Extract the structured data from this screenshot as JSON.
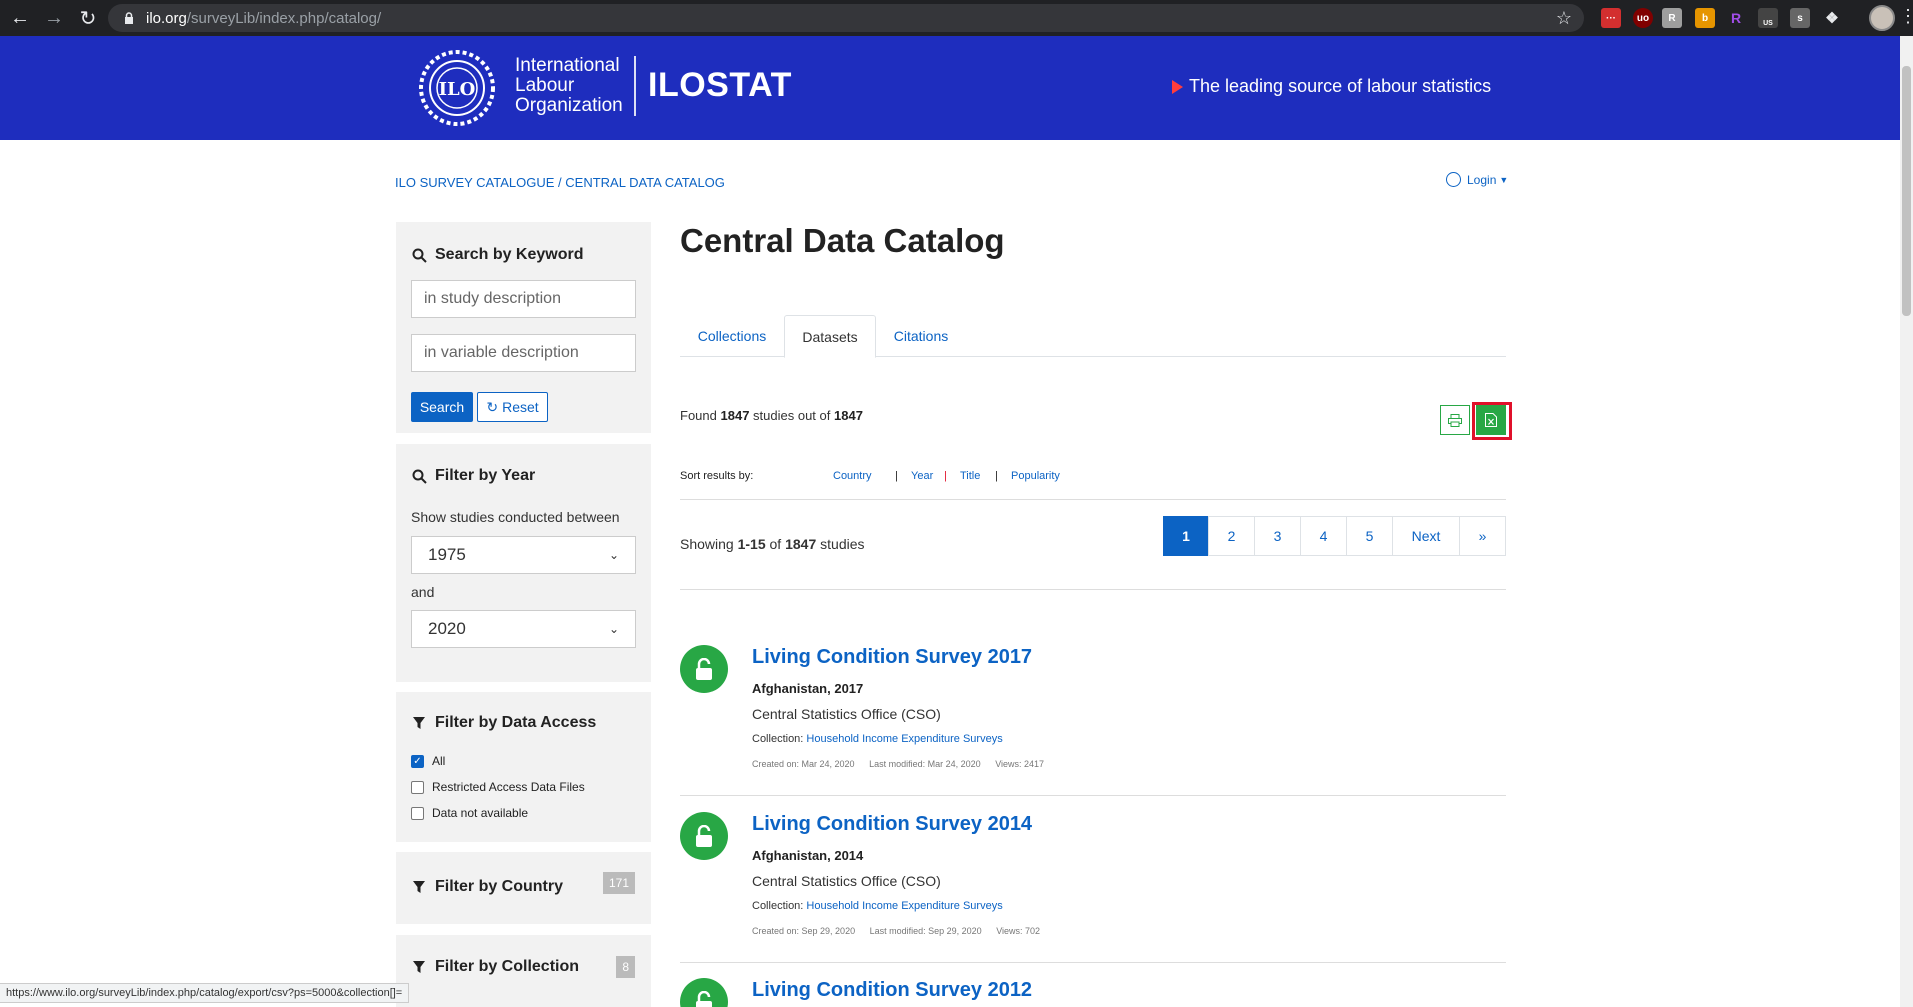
{
  "browser": {
    "url_domain": "ilo.org",
    "url_path": "/surveyLib/index.php/catalog/",
    "extensions": [
      "ext-red-dots",
      "ublock",
      "ext-gray-r",
      "ext-orange",
      "ext-purple-r",
      "ext-us",
      "ext-s",
      "puzzle"
    ],
    "ext_us_label": "US"
  },
  "header": {
    "org_line1": "International",
    "org_line2": "Labour",
    "org_line3": "Organization",
    "brand": "ILOSTAT",
    "tagline": "The leading source of labour statistics",
    "logo_text": "ILO"
  },
  "breadcrumb": {
    "items": [
      "ILO SURVEY CATALOGUE",
      "CENTRAL DATA CATALOG"
    ],
    "separator": " / "
  },
  "login_label": "Login",
  "sidebar": {
    "keyword": {
      "title": "Search by Keyword",
      "study_placeholder": "in study description",
      "variable_placeholder": "in variable description",
      "search_label": "Search",
      "reset_label": "Reset"
    },
    "year": {
      "title": "Filter by Year",
      "between_label": "Show studies conducted between",
      "from": "1975",
      "and_label": "and",
      "to": "2020"
    },
    "access": {
      "title": "Filter by Data Access",
      "options": [
        {
          "label": "All",
          "checked": true
        },
        {
          "label": "Restricted Access Data Files",
          "checked": false
        },
        {
          "label": "Data not available",
          "checked": false
        }
      ]
    },
    "country": {
      "title": "Filter by Country",
      "count": "171"
    },
    "collection": {
      "title": "Filter by Collection",
      "count": "8"
    }
  },
  "main": {
    "title": "Central Data Catalog",
    "tabs": [
      "Collections",
      "Datasets",
      "Citations"
    ],
    "active_tab": "Datasets",
    "found": {
      "prefix": "Found",
      "count": "1847",
      "middle": "studies out of",
      "total": "1847"
    },
    "sort": {
      "label": "Sort results by:",
      "options": [
        "Country",
        "Year",
        "Title",
        "Popularity"
      ],
      "sep": "|"
    },
    "showing": {
      "prefix": "Showing",
      "range": "1-15",
      "of": "of",
      "total": "1847",
      "suffix": "studies"
    },
    "pagination": [
      "1",
      "2",
      "3",
      "4",
      "5",
      "Next",
      "»"
    ],
    "results": [
      {
        "title": "Living Condition Survey 2017",
        "country": "Afghanistan, 2017",
        "agency": "Central Statistics Office (CSO)",
        "collection_label": "Collection:",
        "collection": "Household Income Expenditure Surveys",
        "created": "Created on: Mar 24, 2020",
        "modified": "Last modified: Mar 24, 2020",
        "views": "Views: 2417"
      },
      {
        "title": "Living Condition Survey 2014",
        "country": "Afghanistan, 2014",
        "agency": "Central Statistics Office (CSO)",
        "collection_label": "Collection:",
        "collection": "Household Income Expenditure Surveys",
        "created": "Created on: Sep 29, 2020",
        "modified": "Last modified: Sep 29, 2020",
        "views": "Views: 702"
      },
      {
        "title": "Living Condition Survey 2012"
      }
    ]
  },
  "status_url": "https://www.ilo.org/surveyLib/index.php/catalog/export/csv?ps=5000&collection[]=",
  "colors": {
    "header_blue": "#1e2dbe",
    "link_blue": "#0c63c4",
    "green": "#28a745",
    "highlight_red": "#e0102a",
    "tagline_triangle": "#ff3d3d"
  }
}
